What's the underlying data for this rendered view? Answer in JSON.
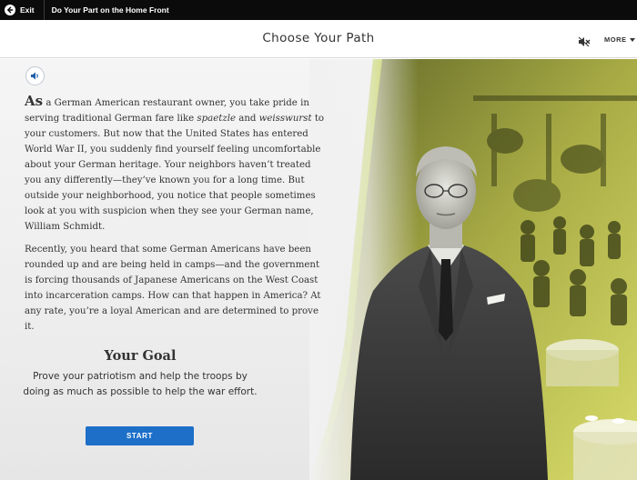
{
  "topbar": {
    "exit_label": "Exit",
    "activity_title": "Do Your Part on the Home Front"
  },
  "header": {
    "title": "Choose Your Path",
    "more_label": "MORE"
  },
  "story": {
    "dropcap": "As",
    "p1_a": " a German American restaurant owner, you take pride in serving traditional German fare like ",
    "p1_em1": "spaetzle",
    "p1_b": " and ",
    "p1_em2": "weisswurst",
    "p1_c": " to your customers. But now that the United States has entered World War II, you suddenly find yourself feeling uncomfortable about your German heritage. Your neighbors haven’t treated you any differently—they’ve known you for a long time. But outside your neighborhood, you notice that people sometimes look at you with suspicion when they see your German name, William Schmidt.",
    "p2": "Recently, you heard that some German Americans have been rounded up and are being held in camps—and the government is forcing thousands of Japanese Americans on the West Coast into incarceration camps. How can that happen in America? At any rate, you’re a loyal American and are determined to prove it."
  },
  "goal": {
    "title": "Your Goal",
    "text": "Prove your patriotism and help the troops by doing as much as possible to help the war effort."
  },
  "start_label": "START",
  "icons": {
    "exit": "back-arrow-icon",
    "mute": "speaker-muted-icon",
    "audio": "speaker-icon",
    "more": "caret-down-icon"
  },
  "colors": {
    "topbar": "#0b0b0b",
    "accent_green": "#b6cc28",
    "button_blue": "#1d6fc8",
    "audio_blue": "#1f5fa8"
  }
}
